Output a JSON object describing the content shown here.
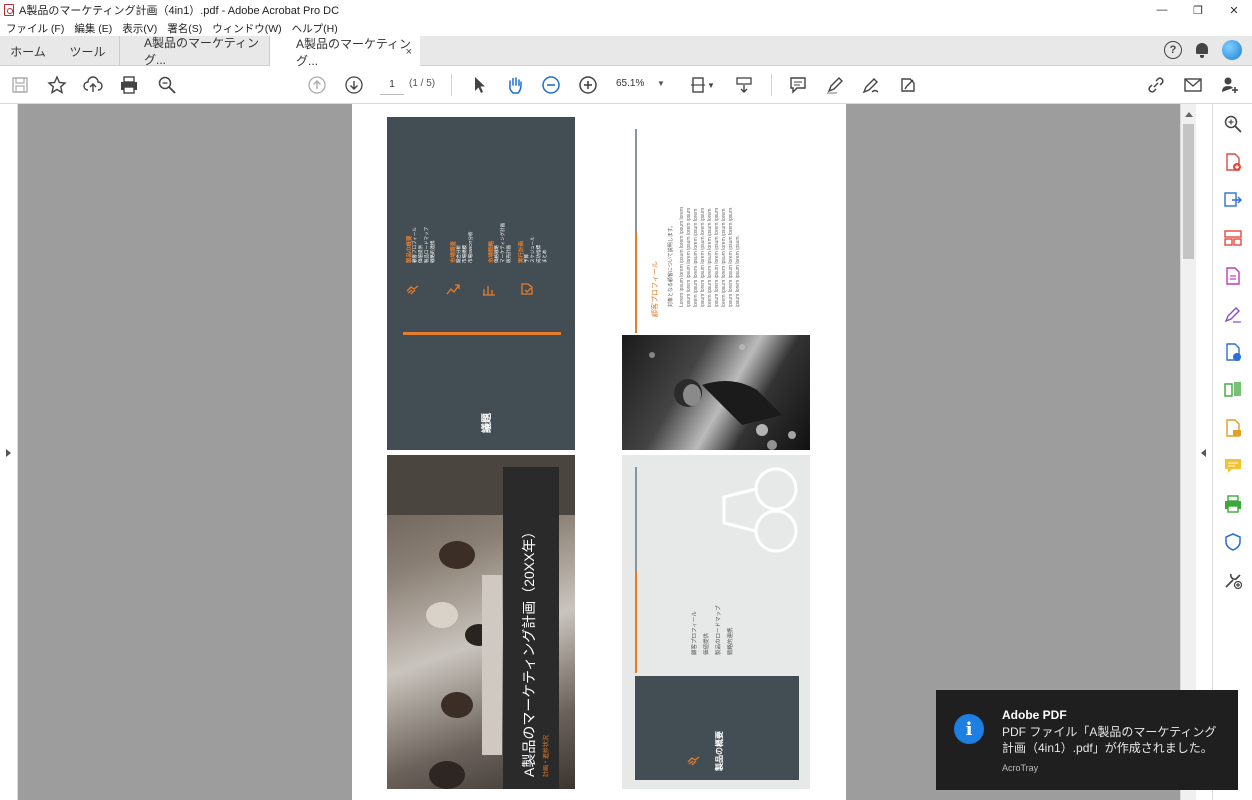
{
  "window": {
    "title": "A製品のマーケティング計画（4in1）.pdf - Adobe Acrobat Pro DC",
    "controls": {
      "minimize": "—",
      "restore": "❐",
      "close": "✕"
    }
  },
  "menu": [
    "ファイル (F)",
    "編集 (E)",
    "表示(V)",
    "署名(S)",
    "ウィンドウ(W)",
    "ヘルプ(H)"
  ],
  "tabs": {
    "home": "ホーム",
    "tools": "ツール",
    "doc1": "A製品のマーケティング...",
    "doc2": "A製品のマーケティング...",
    "close": "×"
  },
  "toolbar": {
    "page_current": "1",
    "page_count": "(1 / 5)",
    "zoom": "65.1%"
  },
  "slide1": {
    "title": "議題",
    "groups": [
      {
        "header": "製品の概要",
        "items": [
          "顧客プロフィール",
          "価値提供",
          "製品ロードマップ",
          "戦略的連携"
        ]
      },
      {
        "header": "市場調査",
        "items": [
          "競合分析",
          "市場規模",
          "市場SWOT分析"
        ]
      },
      {
        "header": "市場戦略",
        "items": [
          "価格戦略",
          "マーケティング計画",
          "販売計画"
        ]
      },
      {
        "header": "実行計画",
        "items": [
          "予算",
          "スケジュール",
          "成功指標",
          "まとめ"
        ]
      }
    ]
  },
  "slide2": {
    "heading": "顧客プロフィール",
    "bullet1": "対象となる顧客について説明します。",
    "lorem": [
      "Lorem ipsum lorem ipsum lorem ipsum lorem",
      "ipsum lorem ipsum lorem ipsum lorem ipsum",
      "lorem ipsum lorem ipsum lorem ipsum lorem",
      "ipsum lorem ipsum lorem ipsum lorem ipsum",
      "lorem ipsum lorem ipsum lorem ipsum lorem",
      "ipsum lorem ipsum lorem ipsum lorem ipsum",
      "lorem ipsum lorem ipsum lorem ipsum lorem",
      "ipsum lorem ipsum lorem ipsum lorem ipsum.",
      "ipsum lorem ipsum lorem ipsum."
    ]
  },
  "slide3": {
    "title": "A製品のマーケティング計画（20XX年）",
    "subtitle": "計画・進捗状況"
  },
  "slide4": {
    "title": "製品の概要",
    "items": [
      "顧客プロフィール",
      "価値提供",
      "製品のロードマップ",
      "戦略的連携"
    ]
  },
  "toast": {
    "title": "Adobe PDF",
    "message": "PDF ファイル「A製品のマーケティング計画（4in1）.pdf」が作成されました。",
    "source": "AcroTray",
    "icon": "i"
  },
  "colors": {
    "accent": "#e57c2b",
    "slate": "#434e54",
    "toast": "#1f1f1f",
    "info": "#1d7fe2"
  }
}
